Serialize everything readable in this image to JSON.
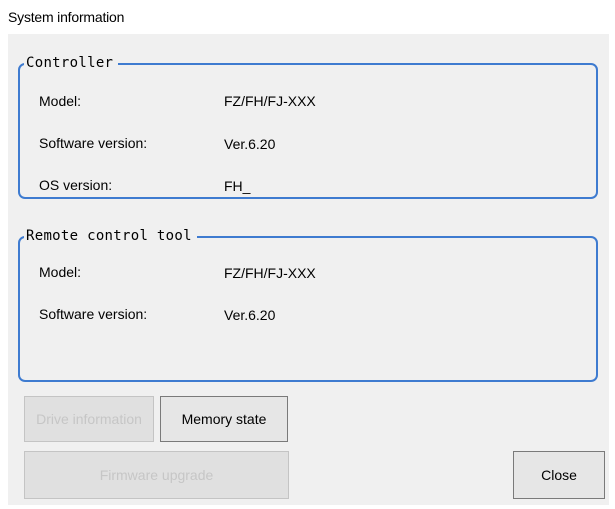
{
  "window": {
    "title": "System information"
  },
  "controller": {
    "legend": "Controller",
    "rows": [
      {
        "label": "Model:",
        "value": "FZ/FH/FJ-XXX"
      },
      {
        "label": "Software version:",
        "value": "Ver.6.20"
      },
      {
        "label": "OS version:",
        "value": "FH_"
      }
    ]
  },
  "remote": {
    "legend": "Remote control tool",
    "rows": [
      {
        "label": "Model:",
        "value": "FZ/FH/FJ-XXX"
      },
      {
        "label": "Software version:",
        "value": "Ver.6.20"
      }
    ]
  },
  "buttons": {
    "drive_information": "Drive information",
    "memory_state": "Memory state",
    "firmware_upgrade": "Firmware upgrade",
    "close": "Close"
  },
  "colors": {
    "group_border": "#3e7bd0",
    "dialog_bg": "#f0f0f0"
  }
}
